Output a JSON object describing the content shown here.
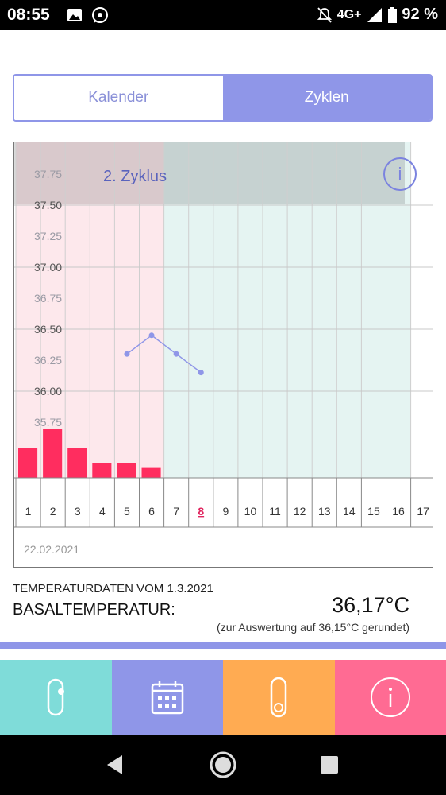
{
  "status_bar": {
    "time": "08:55",
    "network": "4G+",
    "battery": "92 %",
    "left_icons": [
      "image-icon",
      "whatsapp-icon"
    ],
    "right_icons": [
      "mute-icon",
      "signal-icon",
      "battery-icon"
    ]
  },
  "tabs": [
    {
      "label": "Kalender",
      "active": false
    },
    {
      "label": "Zyklen",
      "active": true
    }
  ],
  "chart": {
    "cycle_label": "2. Zyklus",
    "info_icon": "info-icon",
    "start_date": "22.02.2021",
    "today_day": 8
  },
  "chart_data": {
    "type": "line",
    "title": "2. Zyklus",
    "y_ticks": [
      "37.75",
      "37.50",
      "37.25",
      "37.00",
      "36.75",
      "36.50",
      "36.25",
      "36.00",
      "35.75"
    ],
    "ylim": [
      35.75,
      37.75
    ],
    "x": [
      1,
      2,
      3,
      4,
      5,
      6,
      7,
      8,
      9,
      10,
      11,
      12,
      13,
      14,
      15,
      16,
      17
    ],
    "series": [
      {
        "values": [
          null,
          null,
          null,
          null,
          36.3,
          36.45,
          36.3,
          36.15
        ]
      }
    ],
    "bars": {
      "values": [
        3,
        5,
        3,
        1.5,
        1.5,
        1,
        0,
        0,
        0,
        0,
        0,
        0,
        0,
        0,
        0,
        0,
        0
      ]
    },
    "phases": [
      {
        "from_day": 1,
        "to_day": 6,
        "color": "#fde8ec"
      },
      {
        "from_day": 7,
        "to_day": 16,
        "color": "#e5f4f2"
      }
    ],
    "grid": true
  },
  "info": {
    "heading": "TEMPERATURDATEN VOM 1.3.2021",
    "basal_label": "BASALTEMPERATUR:",
    "basal_value": "36,17°C",
    "rounded_note": "(zur Auswertung auf 36,15°C gerundet)"
  },
  "bottom_nav": [
    {
      "icon": "thermometer-icon",
      "color": "#7fdcd9"
    },
    {
      "icon": "calendar-icon",
      "color": "#8f96e8"
    },
    {
      "icon": "thermometer-icon",
      "color": "#ffab52"
    },
    {
      "icon": "info-icon",
      "color": "#ff6b93"
    }
  ],
  "colors": {
    "accent": "#8f96e8",
    "bar": "#ff2d5f",
    "line": "#8f96e8"
  }
}
